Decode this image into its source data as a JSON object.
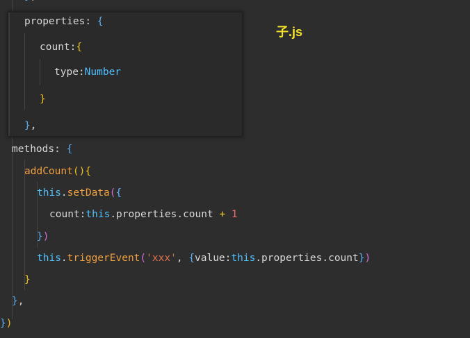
{
  "file_label": "子.js",
  "colors": {
    "background": "#2d2d2d",
    "label": "#f5e12a"
  },
  "lines": [
    {
      "tokens": [
        {
          "c": "b1",
          "t": "}"
        },
        {
          "c": "p",
          "t": ","
        }
      ]
    },
    {
      "tokens": [
        {
          "c": "k",
          "t": "properties"
        },
        {
          "c": "p",
          "t": ": "
        },
        {
          "c": "b1",
          "t": "{"
        }
      ]
    },
    {
      "tokens": [
        {
          "c": "k",
          "t": "count"
        },
        {
          "c": "p",
          "t": ":"
        },
        {
          "c": "b2",
          "t": "{"
        }
      ]
    },
    {
      "tokens": [
        {
          "c": "k",
          "t": "type"
        },
        {
          "c": "p",
          "t": ":"
        },
        {
          "c": "t",
          "t": "Number"
        }
      ]
    },
    {
      "tokens": [
        {
          "c": "b2",
          "t": "}"
        }
      ]
    },
    {
      "tokens": [
        {
          "c": "b1",
          "t": "}"
        },
        {
          "c": "p",
          "t": ","
        }
      ]
    },
    {
      "tokens": [
        {
          "c": "k",
          "t": "methods"
        },
        {
          "c": "p",
          "t": ": "
        },
        {
          "c": "b1",
          "t": "{"
        }
      ]
    },
    {
      "tokens": [
        {
          "c": "f",
          "t": "addCount"
        },
        {
          "c": "b2",
          "t": "()"
        },
        {
          "c": "b2",
          "t": "{"
        }
      ]
    },
    {
      "tokens": [
        {
          "c": "t",
          "t": "this"
        },
        {
          "c": "p",
          "t": "."
        },
        {
          "c": "f",
          "t": "setData"
        },
        {
          "c": "b3",
          "t": "("
        },
        {
          "c": "b1",
          "t": "{"
        }
      ]
    },
    {
      "tokens": [
        {
          "c": "k",
          "t": "count"
        },
        {
          "c": "p",
          "t": ":"
        },
        {
          "c": "t",
          "t": "this"
        },
        {
          "c": "k",
          "t": ".properties.count "
        },
        {
          "c": "op",
          "t": "+"
        },
        {
          "c": "p",
          "t": " "
        },
        {
          "c": "n",
          "t": "1"
        }
      ]
    },
    {
      "tokens": [
        {
          "c": "b1",
          "t": "}"
        },
        {
          "c": "b3",
          "t": ")"
        }
      ]
    },
    {
      "tokens": [
        {
          "c": "t",
          "t": "this"
        },
        {
          "c": "p",
          "t": "."
        },
        {
          "c": "f",
          "t": "triggerEvent"
        },
        {
          "c": "b3",
          "t": "("
        },
        {
          "c": "s",
          "t": "'xxx'"
        },
        {
          "c": "p",
          "t": ", "
        },
        {
          "c": "b1",
          "t": "{"
        },
        {
          "c": "k",
          "t": "value:"
        },
        {
          "c": "t",
          "t": "this"
        },
        {
          "c": "k",
          "t": ".properties.count"
        },
        {
          "c": "b1",
          "t": "}"
        },
        {
          "c": "b3",
          "t": ")"
        }
      ]
    },
    {
      "tokens": [
        {
          "c": "b2",
          "t": "}"
        }
      ]
    },
    {
      "tokens": [
        {
          "c": "b1",
          "t": "}"
        },
        {
          "c": "p",
          "t": ","
        }
      ]
    },
    {
      "tokens": [
        {
          "c": "b1",
          "t": "}"
        },
        {
          "c": "b2",
          "t": ")"
        }
      ]
    }
  ]
}
